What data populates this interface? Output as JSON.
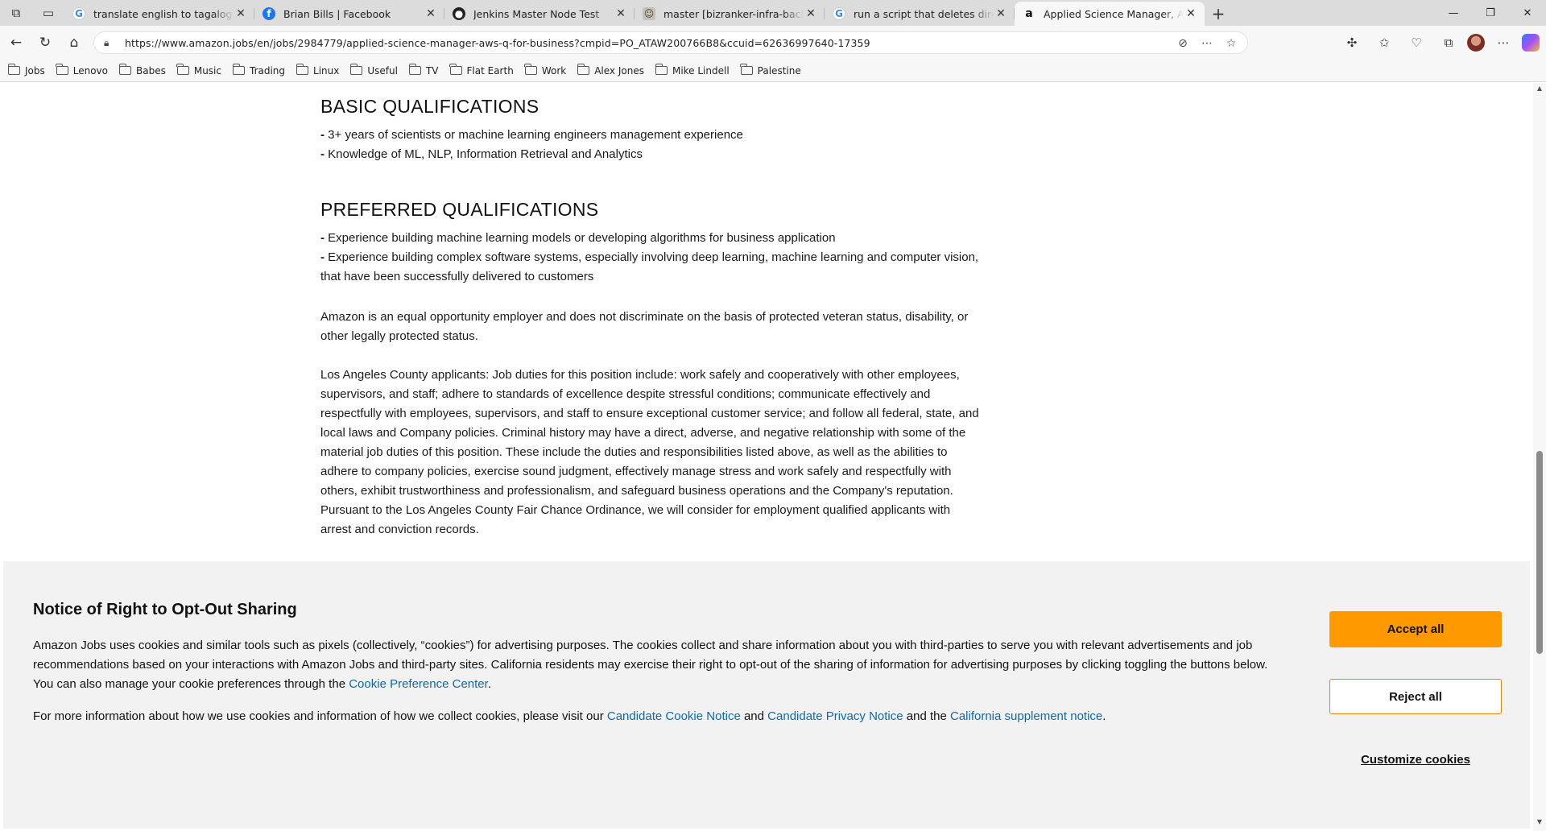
{
  "tabs": [
    {
      "title": "translate english to tagalog - Goo",
      "favicon": "google-icon",
      "active": false
    },
    {
      "title": "Brian Bills | Facebook",
      "favicon": "facebook-icon",
      "active": false
    },
    {
      "title": "Jenkins Master Node Test",
      "favicon": "github-icon",
      "active": false
    },
    {
      "title": "master [bizranker-infra-backup] -",
      "favicon": "repo-avatar-icon",
      "active": false
    },
    {
      "title": "run a script that deletes directorie",
      "favicon": "google-icon",
      "active": false
    },
    {
      "title": "Applied Science Manager, AWS Q",
      "favicon": "amazon-icon",
      "active": true
    }
  ],
  "address_bar": {
    "url": "https://www.amazon.jobs/en/jobs/2984779/applied-science-manager-aws-q-for-business?cmpid=PO_ATAW200766B8&ccuid=62636997640-17359"
  },
  "bookmarks": [
    "Jobs",
    "Lenovo",
    "Babes",
    "Music",
    "Trading",
    "Linux",
    "Useful",
    "TV",
    "Flat Earth",
    "Work",
    "Alex Jones",
    "Mike Lindell",
    "Palestine"
  ],
  "job": {
    "basic_title": "BASIC QUALIFICATIONS",
    "basic_items": [
      "3+ years of scientists or machine learning engineers management experience",
      "Knowledge of ML, NLP, Information Retrieval and Analytics"
    ],
    "preferred_title": "PREFERRED QUALIFICATIONS",
    "preferred_items": [
      "Experience building machine learning models or developing algorithms for business application",
      "Experience building complex software systems, especially involving deep learning, machine learning and computer vision, that have been successfully delivered to customers"
    ],
    "eeo_text": "Amazon is an equal opportunity employer and does not discriminate on the basis of protected veteran status, disability, or other legally protected status.",
    "la_text": "Los Angeles County applicants: Job duties for this position include: work safely and cooperatively with other employees, supervisors, and staff; adhere to standards of excellence despite stressful conditions; communicate effectively and respectfully with employees, supervisors, and staff to ensure exceptional customer service; and follow all federal, state, and local laws and Company policies. Criminal history may have a direct, adverse, and negative relationship with some of the material job duties of this position. These include the duties and responsibilities listed above, as well as the abilities to adhere to company policies, exercise sound judgment, effectively manage stress and work safely and respectfully with others, exhibit trustworthiness and professionalism, and safeguard business operations and the Company's reputation. Pursuant to the Los Angeles County Fair Chance Ordinance, we will consider for employment qualified applicants with arrest and conviction records."
  },
  "cookie_banner": {
    "title": "Notice of Right to Opt-Out Sharing",
    "body1_text": "Amazon Jobs uses cookies and similar tools such as pixels (collectively, “cookies”) for advertising purposes. The cookies collect and share information about you with third-parties to serve you with relevant advertisements and job recommendations based on your interactions with Amazon Jobs and third-party sites. California residents may exercise their right to opt-out of the sharing of information for advertising purposes by clicking toggling the buttons below. You can also manage your cookie preferences through the ",
    "body1_link": "Cookie Preference Center",
    "body1_end": ".",
    "body2_text": "For more information about how we use cookies and information of how we collect cookies, please visit our ",
    "link_cookie_notice": "Candidate Cookie Notice",
    "and1": " and ",
    "link_privacy_notice": "Candidate Privacy Notice",
    "and2": " and the ",
    "link_california": "California supplement notice",
    "body2_end": ".",
    "accept_label": "Accept all",
    "reject_label": "Reject all",
    "customize_label": "Customize cookies",
    "accent_color": "#ff9900"
  }
}
